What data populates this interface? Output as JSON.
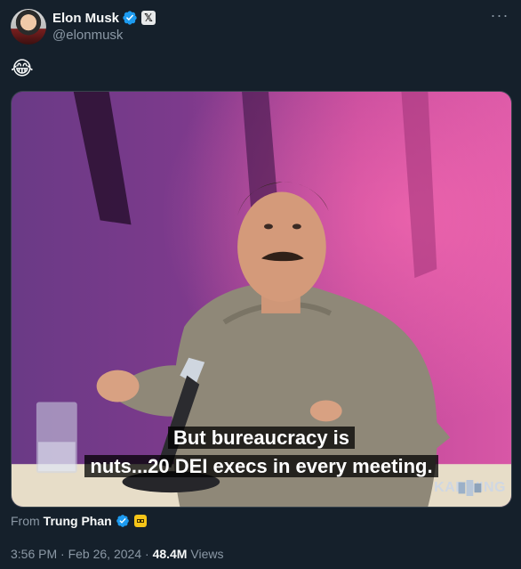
{
  "author": {
    "display_name": "Elon Musk",
    "handle": "@elonmusk",
    "badge_letter": "𝕏"
  },
  "more_label": "···",
  "tweet": {
    "text": "😂"
  },
  "media": {
    "caption_line1": "But bureaucracy is",
    "caption_line2": "nuts...20 DEI execs in every meeting.",
    "watermark": "KAPWING"
  },
  "source": {
    "prefix": "From",
    "name": "Trung Phan"
  },
  "meta": {
    "time": "3:56 PM",
    "separator": "·",
    "date": "Feb 26, 2024",
    "views_count": "48.4M",
    "views_label": "Views"
  },
  "colors": {
    "background": "#15202b",
    "verified": "#1d9bf0",
    "secondary_text": "#8b98a5",
    "border": "#38444d"
  }
}
